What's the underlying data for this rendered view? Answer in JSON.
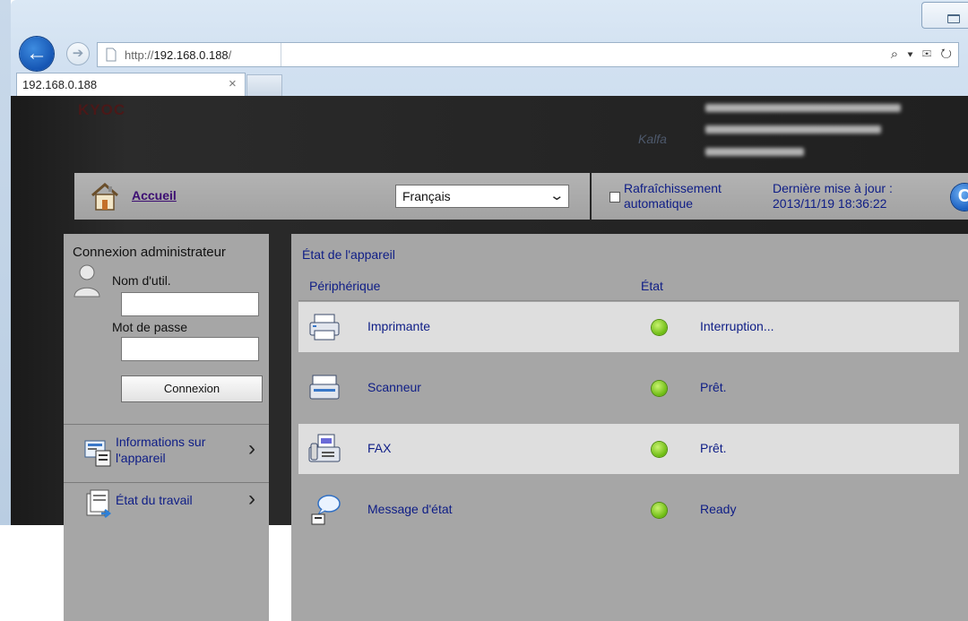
{
  "browser": {
    "url_prefix": "http://",
    "url_host": "192.168.0.188",
    "url_suffix": "/",
    "tab_title": "192.168.0.188",
    "tab_close": "×",
    "addr_tools": "⌕ ▾ ✉ ↻"
  },
  "banner": {
    "brand_logo": "KYOC",
    "model_logo": "Kalfa"
  },
  "header": {
    "home_label": "Accueil",
    "language_selected": "Français",
    "auto_refresh_label_1": "Rafraîchissement",
    "auto_refresh_label_2": "automatique",
    "auto_refresh_checked": false,
    "last_update_label": "Dernière mise à jour :",
    "last_update_value": "2013/11/19 18:36:22",
    "refresh_icon": "refresh-icon"
  },
  "login": {
    "title": "Connexion administrateur",
    "username_label": "Nom d'util.",
    "username_value": "",
    "password_label": "Mot de passe",
    "password_value": "",
    "login_button": "Connexion"
  },
  "nav": {
    "items": [
      {
        "label_1": "Informations sur",
        "label_2": "l'appareil",
        "icon": "device-info-icon"
      },
      {
        "label_1": "État du travail",
        "icon": "job-status-icon"
      }
    ]
  },
  "device_status": {
    "title": "État de l'appareil",
    "col_device": "Périphérique",
    "col_state": "État",
    "rows": [
      {
        "name": "Imprimante",
        "status": "Interruption...",
        "icon": "printer-icon",
        "status_color": "#6cbb11"
      },
      {
        "name": "Scanneur",
        "status": "Prêt.",
        "icon": "scanner-icon",
        "status_color": "#6cbb11"
      },
      {
        "name": "FAX",
        "status": "Prêt.",
        "icon": "fax-icon",
        "status_color": "#6cbb11"
      },
      {
        "name": "Message d'état",
        "status": "Ready",
        "icon": "status-message-icon",
        "status_color": "#6cbb11"
      }
    ]
  },
  "colors": {
    "link_blue": "#0e1d86",
    "home_link_purple": "#3c0d72",
    "panel_gray": "#a6a6a6",
    "row_light": "#dedede",
    "status_green": "#6cbb11"
  }
}
